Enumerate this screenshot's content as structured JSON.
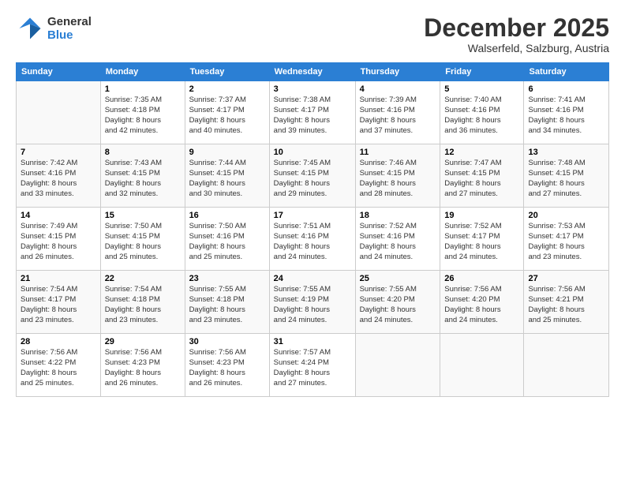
{
  "logo": {
    "line1": "General",
    "line2": "Blue"
  },
  "title": "December 2025",
  "subtitle": "Walserfeld, Salzburg, Austria",
  "days_of_week": [
    "Sunday",
    "Monday",
    "Tuesday",
    "Wednesday",
    "Thursday",
    "Friday",
    "Saturday"
  ],
  "weeks": [
    [
      {
        "day": "",
        "info": ""
      },
      {
        "day": "1",
        "info": "Sunrise: 7:35 AM\nSunset: 4:18 PM\nDaylight: 8 hours\nand 42 minutes."
      },
      {
        "day": "2",
        "info": "Sunrise: 7:37 AM\nSunset: 4:17 PM\nDaylight: 8 hours\nand 40 minutes."
      },
      {
        "day": "3",
        "info": "Sunrise: 7:38 AM\nSunset: 4:17 PM\nDaylight: 8 hours\nand 39 minutes."
      },
      {
        "day": "4",
        "info": "Sunrise: 7:39 AM\nSunset: 4:16 PM\nDaylight: 8 hours\nand 37 minutes."
      },
      {
        "day": "5",
        "info": "Sunrise: 7:40 AM\nSunset: 4:16 PM\nDaylight: 8 hours\nand 36 minutes."
      },
      {
        "day": "6",
        "info": "Sunrise: 7:41 AM\nSunset: 4:16 PM\nDaylight: 8 hours\nand 34 minutes."
      }
    ],
    [
      {
        "day": "7",
        "info": "Sunrise: 7:42 AM\nSunset: 4:16 PM\nDaylight: 8 hours\nand 33 minutes."
      },
      {
        "day": "8",
        "info": "Sunrise: 7:43 AM\nSunset: 4:15 PM\nDaylight: 8 hours\nand 32 minutes."
      },
      {
        "day": "9",
        "info": "Sunrise: 7:44 AM\nSunset: 4:15 PM\nDaylight: 8 hours\nand 30 minutes."
      },
      {
        "day": "10",
        "info": "Sunrise: 7:45 AM\nSunset: 4:15 PM\nDaylight: 8 hours\nand 29 minutes."
      },
      {
        "day": "11",
        "info": "Sunrise: 7:46 AM\nSunset: 4:15 PM\nDaylight: 8 hours\nand 28 minutes."
      },
      {
        "day": "12",
        "info": "Sunrise: 7:47 AM\nSunset: 4:15 PM\nDaylight: 8 hours\nand 27 minutes."
      },
      {
        "day": "13",
        "info": "Sunrise: 7:48 AM\nSunset: 4:15 PM\nDaylight: 8 hours\nand 27 minutes."
      }
    ],
    [
      {
        "day": "14",
        "info": "Sunrise: 7:49 AM\nSunset: 4:15 PM\nDaylight: 8 hours\nand 26 minutes."
      },
      {
        "day": "15",
        "info": "Sunrise: 7:50 AM\nSunset: 4:15 PM\nDaylight: 8 hours\nand 25 minutes."
      },
      {
        "day": "16",
        "info": "Sunrise: 7:50 AM\nSunset: 4:16 PM\nDaylight: 8 hours\nand 25 minutes."
      },
      {
        "day": "17",
        "info": "Sunrise: 7:51 AM\nSunset: 4:16 PM\nDaylight: 8 hours\nand 24 minutes."
      },
      {
        "day": "18",
        "info": "Sunrise: 7:52 AM\nSunset: 4:16 PM\nDaylight: 8 hours\nand 24 minutes."
      },
      {
        "day": "19",
        "info": "Sunrise: 7:52 AM\nSunset: 4:17 PM\nDaylight: 8 hours\nand 24 minutes."
      },
      {
        "day": "20",
        "info": "Sunrise: 7:53 AM\nSunset: 4:17 PM\nDaylight: 8 hours\nand 23 minutes."
      }
    ],
    [
      {
        "day": "21",
        "info": "Sunrise: 7:54 AM\nSunset: 4:17 PM\nDaylight: 8 hours\nand 23 minutes."
      },
      {
        "day": "22",
        "info": "Sunrise: 7:54 AM\nSunset: 4:18 PM\nDaylight: 8 hours\nand 23 minutes."
      },
      {
        "day": "23",
        "info": "Sunrise: 7:55 AM\nSunset: 4:18 PM\nDaylight: 8 hours\nand 23 minutes."
      },
      {
        "day": "24",
        "info": "Sunrise: 7:55 AM\nSunset: 4:19 PM\nDaylight: 8 hours\nand 24 minutes."
      },
      {
        "day": "25",
        "info": "Sunrise: 7:55 AM\nSunset: 4:20 PM\nDaylight: 8 hours\nand 24 minutes."
      },
      {
        "day": "26",
        "info": "Sunrise: 7:56 AM\nSunset: 4:20 PM\nDaylight: 8 hours\nand 24 minutes."
      },
      {
        "day": "27",
        "info": "Sunrise: 7:56 AM\nSunset: 4:21 PM\nDaylight: 8 hours\nand 25 minutes."
      }
    ],
    [
      {
        "day": "28",
        "info": "Sunrise: 7:56 AM\nSunset: 4:22 PM\nDaylight: 8 hours\nand 25 minutes."
      },
      {
        "day": "29",
        "info": "Sunrise: 7:56 AM\nSunset: 4:23 PM\nDaylight: 8 hours\nand 26 minutes."
      },
      {
        "day": "30",
        "info": "Sunrise: 7:56 AM\nSunset: 4:23 PM\nDaylight: 8 hours\nand 26 minutes."
      },
      {
        "day": "31",
        "info": "Sunrise: 7:57 AM\nSunset: 4:24 PM\nDaylight: 8 hours\nand 27 minutes."
      },
      {
        "day": "",
        "info": ""
      },
      {
        "day": "",
        "info": ""
      },
      {
        "day": "",
        "info": ""
      }
    ]
  ]
}
